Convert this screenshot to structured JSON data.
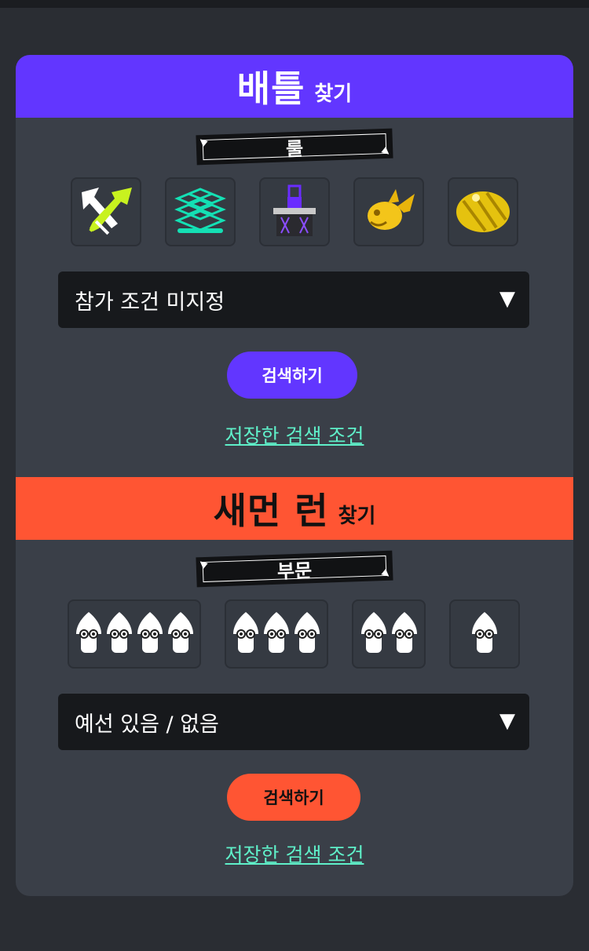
{
  "battle": {
    "title": "배틀",
    "title_suffix": "찾기",
    "section_label": "룰",
    "rules": [
      {
        "name": "turf-war-icon"
      },
      {
        "name": "splat-zones-icon"
      },
      {
        "name": "tower-control-icon"
      },
      {
        "name": "rainmaker-icon"
      },
      {
        "name": "clam-blitz-icon"
      }
    ],
    "filter_value": "참가 조건 미지정",
    "search_label": "검색하기",
    "saved_link": "저장한 검색 조건",
    "accent": "#6236ff"
  },
  "salmon": {
    "title": "새먼 런",
    "title_suffix": "찾기",
    "section_label": "부문",
    "player_counts": [
      4,
      3,
      2,
      1
    ],
    "filter_value": "예선 있음 / 없음",
    "search_label": "검색하기",
    "saved_link": "저장한 검색 조건",
    "accent": "#ff5533"
  },
  "colors": {
    "background": "#2a2d33",
    "card": "#3a3f48",
    "link": "#5ff0c9"
  }
}
